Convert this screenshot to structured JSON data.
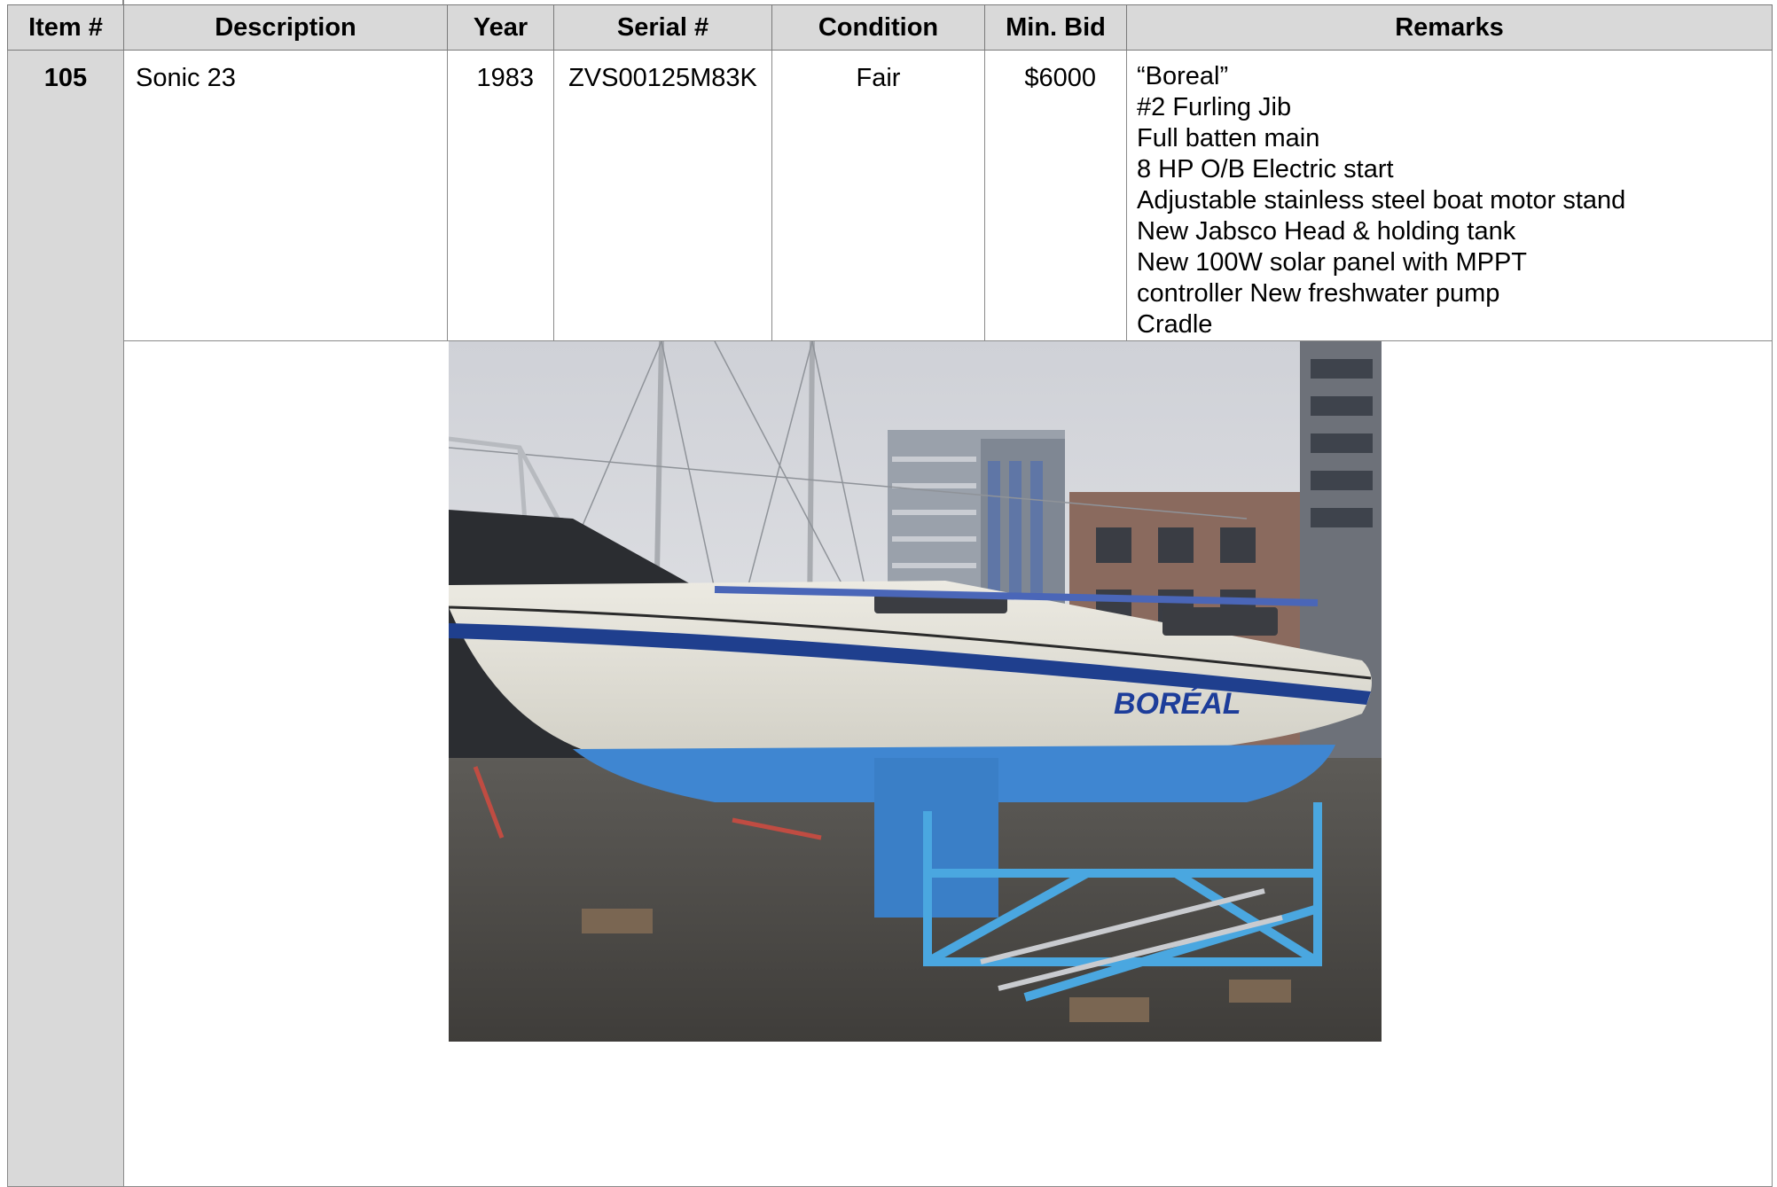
{
  "table": {
    "headers": [
      "Item #",
      "Description",
      "Year",
      "Serial #",
      "Condition",
      "Min. Bid",
      "Remarks"
    ],
    "row": {
      "item": "105",
      "description": "Sonic 23",
      "year": "1983",
      "serial": "ZVS00125M83K",
      "condition": "Fair",
      "min_bid": "$6000",
      "remarks": [
        "“Boreal”",
        "#2 Furling Jib",
        "Full batten main",
        "8 HP O/B Electric start",
        "Adjustable stainless steel boat motor stand",
        "New Jabsco Head & holding tank",
        "New 100W solar panel with MPPT",
        "controller New freshwater pump",
        "Cradle"
      ]
    }
  },
  "photo": {
    "hull_name": "BORÉAL",
    "colors": {
      "hull": "#e4e2d9",
      "stripe": "#1f3f8e",
      "bottom": "#3f86d1",
      "cradle": "#4aa7e0",
      "sky": "#d7d8dc"
    }
  }
}
